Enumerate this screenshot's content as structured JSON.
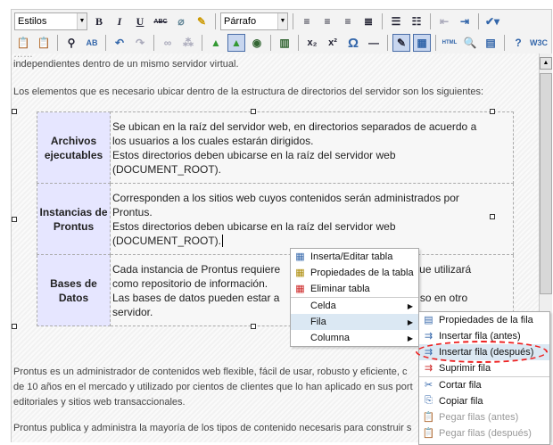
{
  "toolbar": {
    "styles_select": "Estilos",
    "format_select": "Párrafo",
    "row1_icons": [
      "bold-icon",
      "italic-icon",
      "underline-icon",
      "strikethrough-icon",
      "eraser-icon",
      "cleanup-brush-icon",
      "align-left-icon",
      "align-center-icon",
      "align-right-icon",
      "align-justify-icon",
      "bullet-list-icon",
      "numbered-list-icon",
      "outdent-icon",
      "indent-icon",
      "spellcheck-icon"
    ],
    "row2_icons": [
      "paste-text-icon",
      "paste-word-icon",
      "find-icon",
      "replace-icon",
      "undo-icon",
      "redo-icon",
      "link-icon",
      "unlink-icon",
      "image-icon",
      "image-manager-icon",
      "media-icon",
      "film-icon",
      "subscript-icon",
      "superscript-icon",
      "special-char-icon",
      "horizontal-rule-icon",
      "visual-aid-icon",
      "table-icon",
      "html-icon",
      "preview-icon",
      "template-icon",
      "help-icon",
      "w3c-icon"
    ],
    "labels": {
      "bold": "B",
      "italic": "I",
      "underline": "U",
      "strike": "ABC",
      "html": "HTML",
      "w3c": "W3C",
      "omega": "Ω"
    }
  },
  "content": {
    "line_partial": "independientes dentro de un mismo servidor virtual.",
    "intro": "Los elementos que es necesario ubicar dentro de la estructura de directorios del servidor son los siguientes:",
    "table": [
      {
        "header": "Archivos ejecutables",
        "lines": [
          "Se ubican en la raíz del servidor web, en directorios separados de acuerdo a",
          "los usuarios a los cuales estarán dirigidos.",
          "Estos directorios deben ubicarse en la raíz del servidor web",
          "(DOCUMENT_ROOT)."
        ]
      },
      {
        "header": "Instancias de Prontus",
        "lines": [
          "Corresponden a los sitios web cuyos contenidos serán administrados por",
          "Prontus.",
          "Estos directorios deben ubicarse en la raíz del servidor web",
          "(DOCUMENT_ROOT)."
        ]
      },
      {
        "header": "Bases de Datos",
        "lines": [
          "Cada instancia de Prontus requiere",
          "tos que utilizará",
          "como repositorio de información.",
          "Las bases de datos pueden estar a",
          ", incluso en otro",
          "servidor."
        ]
      }
    ],
    "para1": [
      "Prontus es un administrador de contenidos web flexible, fácil de usar, robusto y eficiente, c",
      "de 10 años en el mercado y utilizado por cientos de clientes que lo han aplicado en sus port",
      "editoriales y sitios web transaccionales."
    ],
    "para2": "Prontus publica y administra la mayoría de los tipos de contenido necesaris para construir s"
  },
  "context_menu": {
    "items": [
      {
        "label": "Inserta/Editar tabla",
        "icon": "table-edit-icon"
      },
      {
        "label": "Propiedades de la tabla",
        "icon": "table-properties-icon"
      },
      {
        "label": "Eliminar tabla",
        "icon": "table-delete-icon"
      },
      {
        "label": "Celda"
      },
      {
        "label": "Fila",
        "highlighted": true
      },
      {
        "label": "Columna"
      }
    ]
  },
  "row_submenu": {
    "items": [
      {
        "label": "Propiedades de la fila",
        "icon": "row-properties-icon"
      },
      {
        "label": "Insertar fila (antes)",
        "icon": "insert-row-before-icon"
      },
      {
        "label": "Insertar fila (después)",
        "icon": "insert-row-after-icon",
        "highlighted": true,
        "annotated": true
      },
      {
        "label": "Suprimir fila",
        "icon": "delete-row-icon"
      },
      {
        "label": "Cortar fila",
        "icon": "cut-icon"
      },
      {
        "label": "Copiar fila",
        "icon": "copy-icon"
      },
      {
        "label": "Pegar filas (antes)",
        "icon": "paste-icon",
        "disabled": true
      },
      {
        "label": "Pegar filas (después)",
        "icon": "paste-icon",
        "disabled": true
      }
    ]
  },
  "colors": {
    "highlight": "#dbe8f3",
    "header_cell": "#e6e6ff",
    "annotation": "#e22222"
  }
}
